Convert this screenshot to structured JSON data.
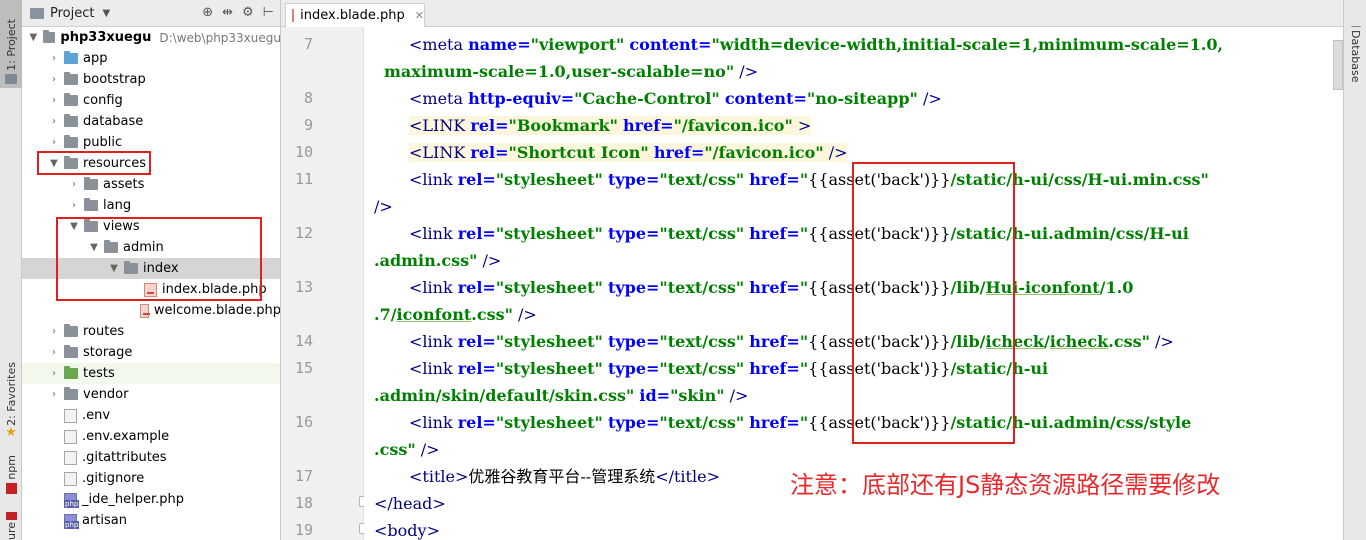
{
  "left_strip": {
    "project_tab": "1: Project",
    "favorites_tab": "2: Favorites",
    "npm_tab": "npm",
    "structure_tab": "ure"
  },
  "project_panel": {
    "title": "Project",
    "tools": [
      "⊕",
      "⇹",
      "⚙",
      "⊢"
    ],
    "root": {
      "name": "php33xuegu",
      "path": "D:\\web\\php33xuegu"
    },
    "items": [
      {
        "label": "app",
        "type": "folder-blue"
      },
      {
        "label": "bootstrap",
        "type": "folder"
      },
      {
        "label": "config",
        "type": "folder"
      },
      {
        "label": "database",
        "type": "folder"
      },
      {
        "label": "public",
        "type": "folder"
      },
      {
        "label": "resources",
        "type": "folder"
      },
      {
        "label": "assets",
        "type": "folder"
      },
      {
        "label": "lang",
        "type": "folder"
      },
      {
        "label": "views",
        "type": "folder"
      },
      {
        "label": "admin",
        "type": "folder"
      },
      {
        "label": "index",
        "type": "folder"
      },
      {
        "label": "index.blade.php",
        "type": "blade"
      },
      {
        "label": "welcome.blade.php",
        "type": "blade"
      },
      {
        "label": "routes",
        "type": "folder"
      },
      {
        "label": "storage",
        "type": "folder"
      },
      {
        "label": "tests",
        "type": "folder-green"
      },
      {
        "label": "vendor",
        "type": "folder"
      },
      {
        "label": ".env",
        "type": "file"
      },
      {
        "label": ".env.example",
        "type": "file"
      },
      {
        "label": ".gitattributes",
        "type": "file"
      },
      {
        "label": ".gitignore",
        "type": "file"
      },
      {
        "label": "_ide_helper.php",
        "type": "php"
      },
      {
        "label": "artisan",
        "type": "php"
      }
    ]
  },
  "editor": {
    "tab_label": "index.blade.php",
    "line_numbers": [
      "7",
      "8",
      "9",
      "10",
      "11",
      "12",
      "13",
      "14",
      "15",
      "16",
      "17",
      "18",
      "19"
    ],
    "asset_expr": "{{asset('back')}}",
    "note": "注意：底部还有JS静态资源路径需要修改",
    "title_text": "优雅谷教育平台--管理系统"
  },
  "right_strip": {
    "database_tab": "Database"
  },
  "colors": {
    "annotation_red": "#e0201d",
    "tag": "#000080",
    "attr": "#0000ff",
    "string": "#008000",
    "highlight": "#fbf6dc"
  }
}
